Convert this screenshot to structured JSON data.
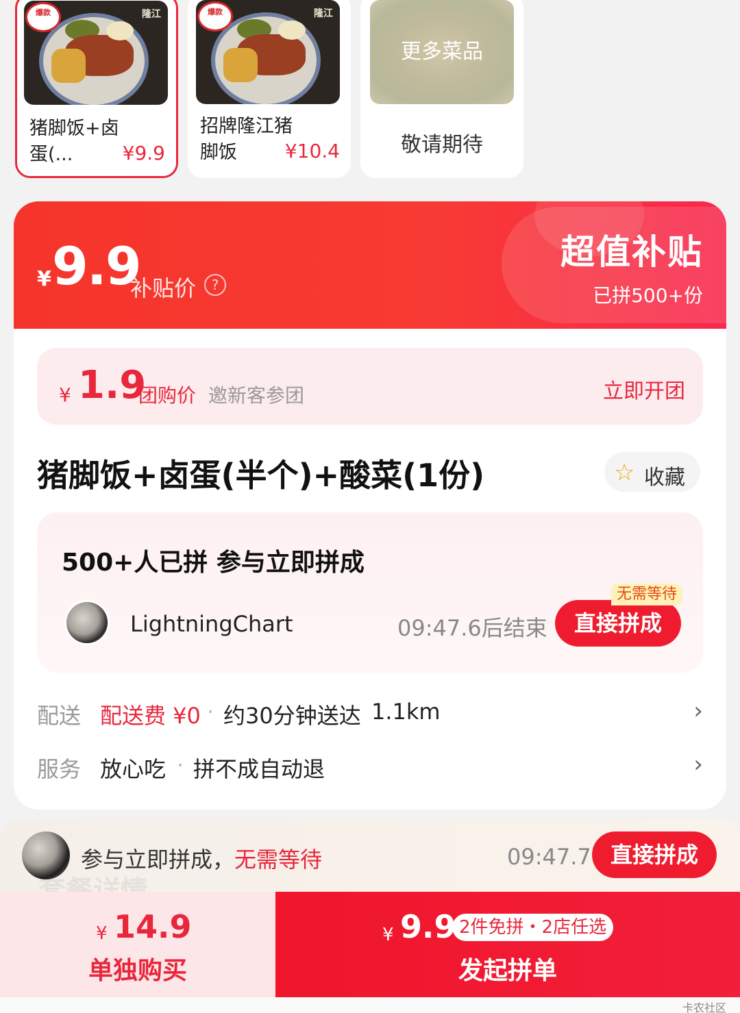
{
  "dishes": [
    {
      "badge": "爆款",
      "brand": "隆江",
      "name": "猪脚饭+卤蛋(...",
      "price": "¥9.9"
    },
    {
      "badge": "爆款",
      "brand": "隆江",
      "name": "招牌隆江猪脚饭",
      "price": "¥10.4"
    }
  ],
  "more": {
    "title": "更多菜品",
    "subtitle": "敬请期待"
  },
  "banner": {
    "yen": "¥",
    "price": "9.9",
    "price_label": "补贴价",
    "help_icon": "?",
    "title": "超值补贴",
    "sold": "已拼500+份"
  },
  "group": {
    "yen": "¥",
    "price": "1.9",
    "label": "团购价",
    "note": "邀新客参团",
    "action": "立即开团"
  },
  "product": {
    "title": "猪脚饭+卤蛋(半个)+酸菜(1份)",
    "fav_label": "收藏",
    "fav_icon": "star-outline-icon"
  },
  "join": {
    "heading": "500+人已拼 参与立即拼成",
    "user": "LightningChart",
    "countdown": "09:47.6后结束",
    "tag": "无需等待",
    "button": "直接拼成"
  },
  "delivery": {
    "label": "配送",
    "fee": "配送费 ¥0",
    "time": "约30分钟送达",
    "distance": "1.1km"
  },
  "service": {
    "label": "服务",
    "item1": "放心吃",
    "item2": "拼不成自动退"
  },
  "notify": {
    "ghost": "套餐详情",
    "text": "参与立即拼成，",
    "highlight": "无需等待",
    "time": "09:47.7",
    "button": "直接拼成"
  },
  "bottom": {
    "alone_yen": "¥",
    "alone_price": "14.9",
    "alone_label": "单独购买",
    "group_yen": "¥",
    "group_price": "9.9",
    "group_tag": "2件免拼・2店任选",
    "group_label": "发起拼单"
  },
  "watermark": "卡农社区",
  "colors": {
    "accent": "#e8273c",
    "banner": "#f5352b",
    "button": "#ee1c2e"
  }
}
